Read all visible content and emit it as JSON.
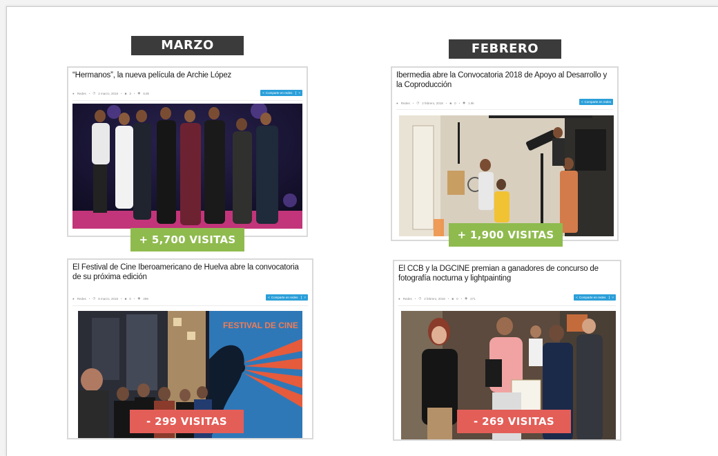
{
  "columns": [
    {
      "month": "MARZO",
      "articles": [
        {
          "title": "“Hermanos”, la nueva película de Archie López",
          "meta": [
            "Redes",
            "2 marzo, 2018",
            "3",
            "5.8k"
          ],
          "share_label": "Comparte en redes",
          "visits": "+ 5,700 VISITAS",
          "visits_status": "up"
        },
        {
          "title": "El Festival de Cine Iberoamericano de Huelva abre la convocatoria de su próxima edición",
          "meta": [
            "Redes",
            "8 marzo, 2018",
            "0",
            "299"
          ],
          "share_label": "Comparte en redes",
          "visits": "- 299 VISITAS",
          "visits_status": "down"
        }
      ]
    },
    {
      "month": "FEBRERO",
      "articles": [
        {
          "title": "Ibermedia abre la Convocatoria 2018 de Apoyo al Desarrollo y la Coproducción",
          "meta": [
            "Redes",
            "2 febrero, 2018",
            "0",
            "1.9k"
          ],
          "share_label": "Comparte en redes",
          "visits": "+ 1,900 VISITAS",
          "visits_status": "up"
        },
        {
          "title": "El CCB y la DGCINE premian a ganadores de concurso de fotografía nocturna y lightpainting",
          "meta": [
            "Redes",
            "2 febrero, 2018",
            "0",
            "271"
          ],
          "share_label": "Comparte en redes",
          "visits": "- 269 VISITAS",
          "visits_status": "down"
        }
      ]
    }
  ],
  "colors": {
    "month_bg": "#3b3b3b",
    "badge_up": "#8fbb4e",
    "badge_down": "#e45e58",
    "share_button": "#2b9fd9"
  },
  "icons": [
    "user-icon",
    "clock-icon",
    "comment-icon",
    "eye-icon",
    "share-icon",
    "chevron-down-icon"
  ]
}
